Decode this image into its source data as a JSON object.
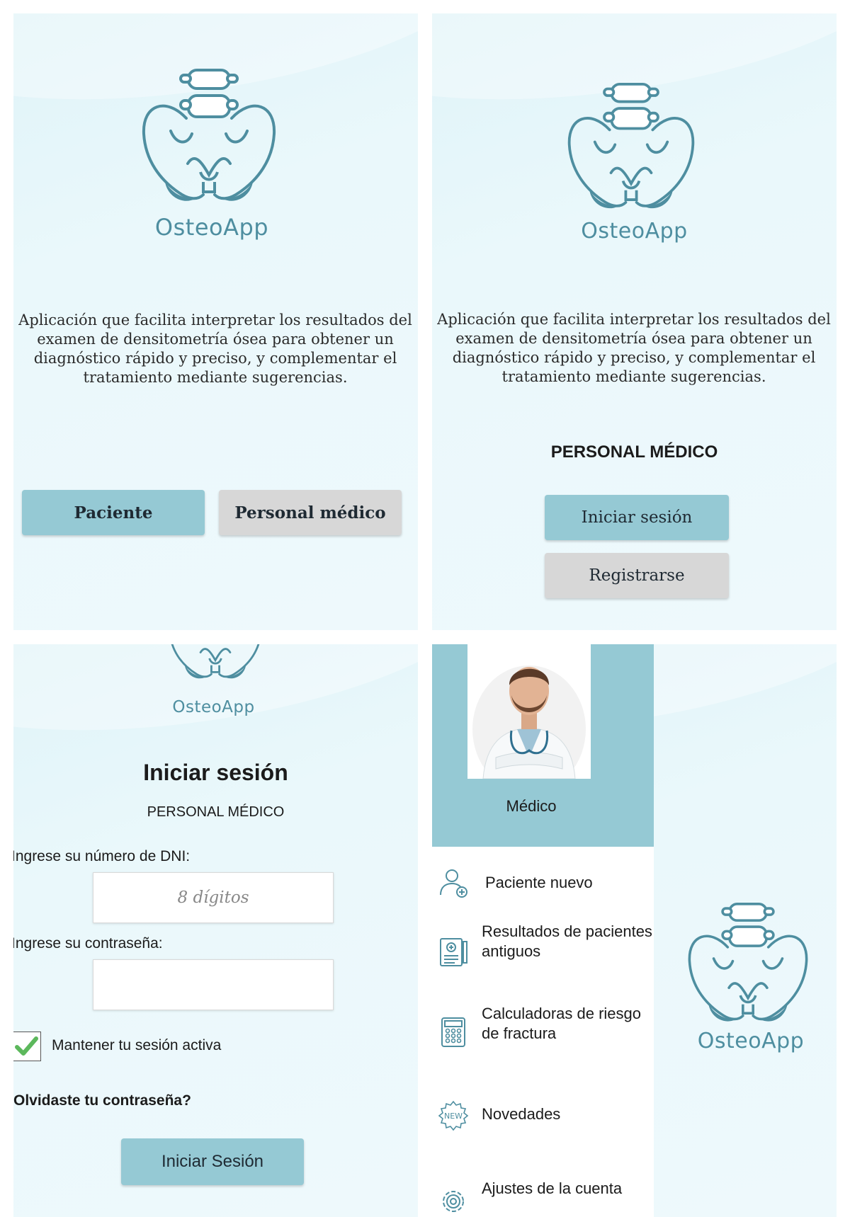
{
  "app_name": "OsteoApp",
  "description": "Aplicación que facilita interpretar los resultados del examen de densitometría ósea para obtener un diagnóstico rápido y preciso, y complementar el tratamiento mediante sugerencias.",
  "screen1": {
    "patient_button": "Paciente",
    "medical_button": "Personal médico"
  },
  "screen2": {
    "section_title": "PERSONAL MÉDICO",
    "login_button": "Iniciar sesión",
    "register_button": "Registrarse"
  },
  "screen3": {
    "title": "Iniciar sesión",
    "subtitle": "PERSONAL MÉDICO",
    "dni_label": "Ingrese su número de DNI:",
    "dni_placeholder": "8 dígitos",
    "password_label": "Ingrese su contraseña:",
    "password_value": "",
    "keep_session_label": "Mantener tu sesión activa",
    "keep_session_checked": true,
    "forgot_password": "Olvidaste tu contraseña?",
    "submit_button": "Iniciar Sesión"
  },
  "screen4": {
    "user_role": "Médico",
    "menu": [
      {
        "label": "Paciente nuevo",
        "icon": "new-patient-icon"
      },
      {
        "label": "Resultados de pacientes antiguos",
        "icon": "clipboard-icon"
      },
      {
        "label": "Calculadoras de riesgo de fractura",
        "icon": "calculator-icon"
      },
      {
        "label": "Novedades",
        "icon": "new-badge-icon"
      },
      {
        "label": "Ajustes de la cuenta",
        "icon": "gear-icon"
      }
    ]
  },
  "colors": {
    "accent": "#95c9d4",
    "logo": "#4e8ea0",
    "secondary_button": "#d7d7d7",
    "background": "#eaf8fb"
  }
}
